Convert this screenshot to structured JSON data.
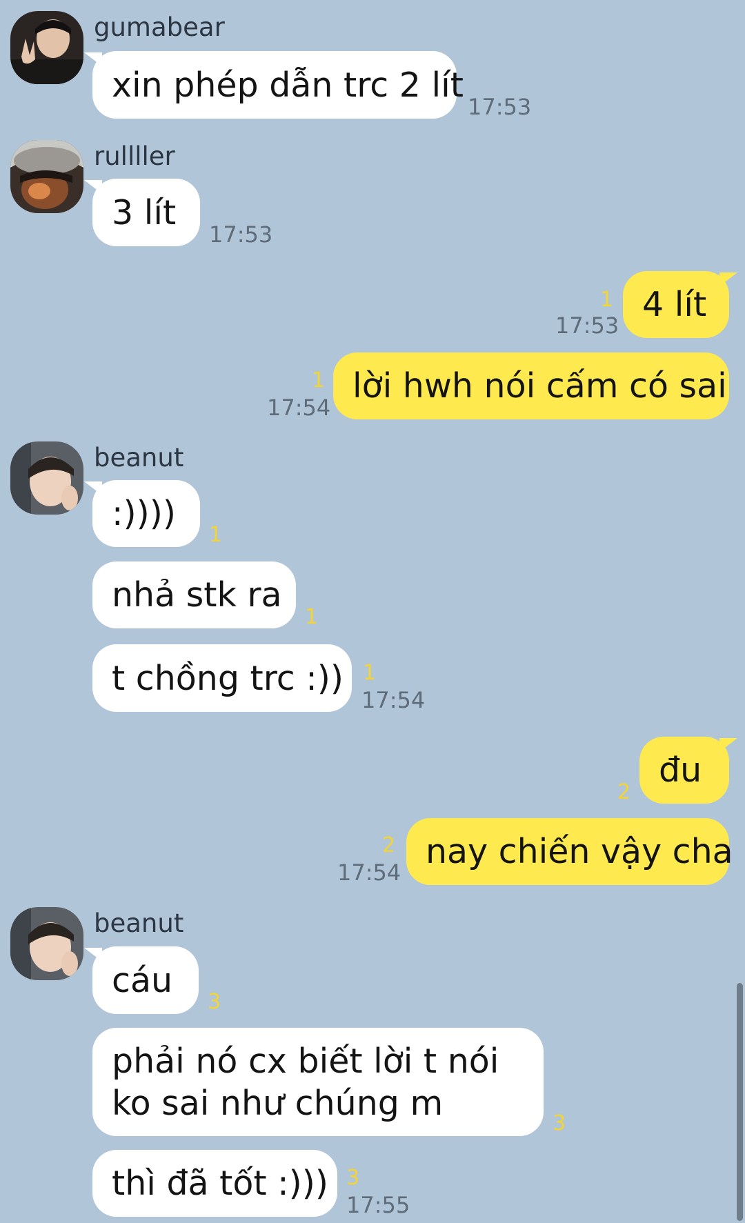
{
  "messages": [
    {
      "sender": "gumabear",
      "avatar_icon": "user-avatar-gumabear",
      "text": "xin phép dẫn trc 2 lít",
      "time": "17:53"
    },
    {
      "sender": "rullller",
      "avatar_icon": "user-avatar-rullller",
      "text": "3 lít",
      "time": "17:53"
    },
    {
      "self": true,
      "text": "4 lít",
      "unread": "1",
      "time": "17:53"
    },
    {
      "self": true,
      "text": "lời hwh nói cấm có sai",
      "unread": "1",
      "time": "17:54"
    },
    {
      "sender": "beanut",
      "avatar_icon": "user-avatar-beanut",
      "text": ":))))",
      "unread": "1"
    },
    {
      "text": "nhả stk ra",
      "unread": "1"
    },
    {
      "text": "t chồng trc :))",
      "unread": "1",
      "time": "17:54"
    },
    {
      "self": true,
      "text": "đu",
      "unread": "2"
    },
    {
      "self": true,
      "text": "nay chiến vậy cha",
      "unread": "2",
      "time": "17:54"
    },
    {
      "sender": "beanut",
      "avatar_icon": "user-avatar-beanut",
      "text": "cáu",
      "unread": "3"
    },
    {
      "text": "phải nó cx biết lời t nói ko sai như chúng m",
      "unread": "3"
    },
    {
      "text": "thì đã tốt :)))",
      "unread": "3",
      "time": "17:55"
    }
  ],
  "colors": {
    "background": "#b1c5d9",
    "incoming_bubble": "#ffffff",
    "outgoing_bubble": "#fee94e",
    "unread_count": "#f2d535",
    "timestamp": "#5e6b78"
  }
}
